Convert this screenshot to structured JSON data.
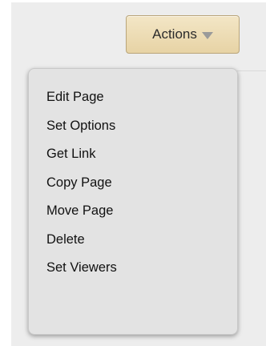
{
  "actions_button": {
    "label": "Actions",
    "caret_icon": "caret-down-icon"
  },
  "menu": {
    "items": [
      {
        "label": "Edit Page"
      },
      {
        "label": "Set Options"
      },
      {
        "label": "Get Link"
      },
      {
        "label": "Copy Page"
      },
      {
        "label": "Move Page"
      },
      {
        "label": "Delete"
      },
      {
        "label": "Set Viewers"
      }
    ]
  },
  "colors": {
    "page_background": "#ededed",
    "button_fill": "#ecdcb4",
    "button_border": "#b9a57a",
    "menu_background": "#e3e3e3",
    "menu_text": "#111111"
  }
}
